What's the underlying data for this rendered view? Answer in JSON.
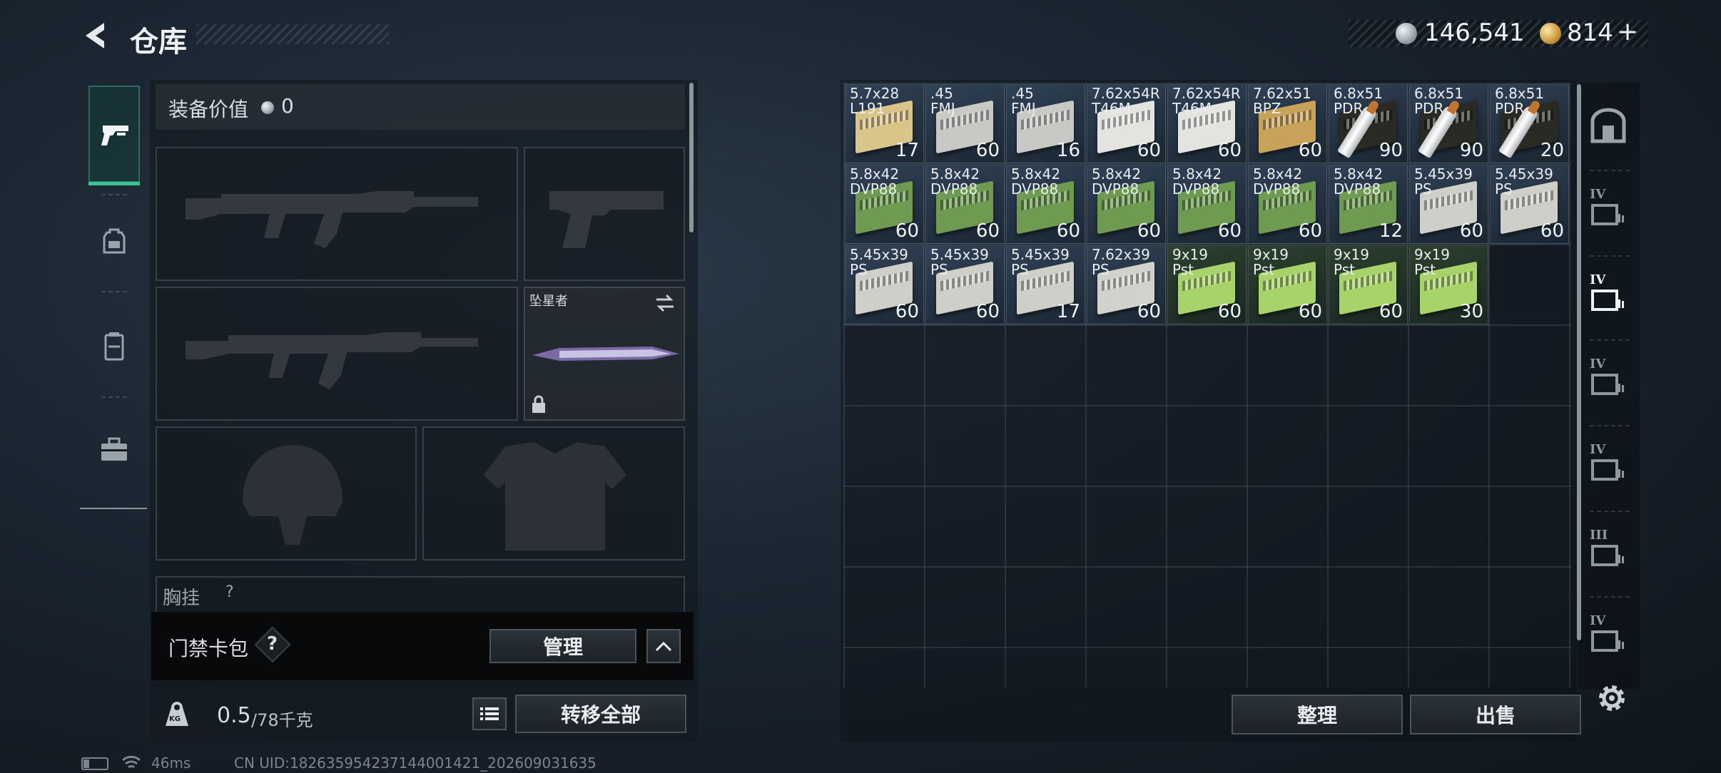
{
  "header": {
    "title": "仓库",
    "silver_amount": "146,541",
    "gold_amount": "814",
    "gold_plus": "+"
  },
  "tabs": [
    {
      "icon": "pistol-icon",
      "active": true
    },
    {
      "icon": "backpack-icon",
      "active": false
    },
    {
      "icon": "chest-rig-icon",
      "active": false
    },
    {
      "icon": "toolbox-icon",
      "active": false
    }
  ],
  "equipment": {
    "value_label": "装备价值",
    "value_amount": "0",
    "melee_name": "坠星者",
    "chest_rig_label": "胸挂",
    "chest_rig_hint": "?"
  },
  "keycard": {
    "label": "门禁卡包",
    "help": "?",
    "manage_label": "管理"
  },
  "weight": {
    "current": "0.5",
    "max_unit": "/78千克",
    "kg_icon_text": "KG",
    "transfer_all_label": "转移全部"
  },
  "stash": {
    "columns": 9,
    "rows_visible": 7,
    "items": [
      {
        "name": "5.7x28\nL191",
        "qty": "17",
        "color": "#d9c58a"
      },
      {
        "name": ".45\nFMJ",
        "qty": "60",
        "color": "#c8c8c4"
      },
      {
        "name": ".45\nFMJ",
        "qty": "16",
        "color": "#c8c8c4"
      },
      {
        "name": "7.62x54R\nT46M",
        "qty": "60",
        "color": "#e3e3e0"
      },
      {
        "name": "7.62x54R\nT46M",
        "qty": "60",
        "color": "#e3e3e0"
      },
      {
        "name": "7.62x51\nBPZ",
        "qty": "60",
        "color": "#c9a25a"
      },
      {
        "name": "6.8x51\nPDR",
        "qty": "90",
        "color": "#2a2a24",
        "bullet": true
      },
      {
        "name": "6.8x51\nPDR",
        "qty": "90",
        "color": "#2a2a24",
        "bullet": true
      },
      {
        "name": "6.8x51\nPDR",
        "qty": "20",
        "color": "#2a2a24",
        "bullet": true
      },
      {
        "name": "5.8x42\nDVP88",
        "qty": "60",
        "color": "#6f9a52"
      },
      {
        "name": "5.8x42\nDVP88",
        "qty": "60",
        "color": "#6f9a52"
      },
      {
        "name": "5.8x42\nDVP88",
        "qty": "60",
        "color": "#6f9a52"
      },
      {
        "name": "5.8x42\nDVP88",
        "qty": "60",
        "color": "#6f9a52"
      },
      {
        "name": "5.8x42\nDVP88",
        "qty": "60",
        "color": "#6f9a52"
      },
      {
        "name": "5.8x42\nDVP88",
        "qty": "60",
        "color": "#6f9a52"
      },
      {
        "name": "5.8x42\nDVP88",
        "qty": "12",
        "color": "#6f9a52"
      },
      {
        "name": "5.45x39\nPS",
        "qty": "60",
        "color": "#cfcfca"
      },
      {
        "name": "5.45x39\nPS",
        "qty": "60",
        "color": "#cfcfca"
      },
      {
        "name": "5.45x39\nPS",
        "qty": "60",
        "color": "#cfcfca"
      },
      {
        "name": "5.45x39\nPS",
        "qty": "60",
        "color": "#cfcfca"
      },
      {
        "name": "5.45x39\nPS",
        "qty": "17",
        "color": "#cfcfca"
      },
      {
        "name": "7.62x39\nPS",
        "qty": "60",
        "color": "#d2d2cc"
      },
      {
        "name": "9x19\nPst",
        "qty": "60",
        "color": "#a8d26a"
      },
      {
        "name": "9x19\nPst",
        "qty": "60",
        "color": "#a8d26a"
      },
      {
        "name": "9x19\nPst",
        "qty": "60",
        "color": "#a8d26a"
      },
      {
        "name": "9x19\nPst",
        "qty": "30",
        "color": "#a8d26a"
      }
    ],
    "sort_label": "整理",
    "sell_label": "出售"
  },
  "side_tabs": [
    "safe-icon",
    "container-tier-iv-icon",
    "container-tier-iv-icon",
    "container-tier-iv-icon",
    "container-tier-iv-icon",
    "container-tier-iii-icon",
    "container-tier-iv-icon"
  ],
  "side_tab_labels": [
    "IV",
    "IV",
    "IV",
    "IV",
    "III",
    "IV"
  ],
  "status": {
    "ping": "46ms",
    "uid": "CN UID:18263595423714400142​1_202609031635"
  },
  "colors": {
    "accent_green": "#37c596",
    "panel_dark": "#07090b"
  }
}
